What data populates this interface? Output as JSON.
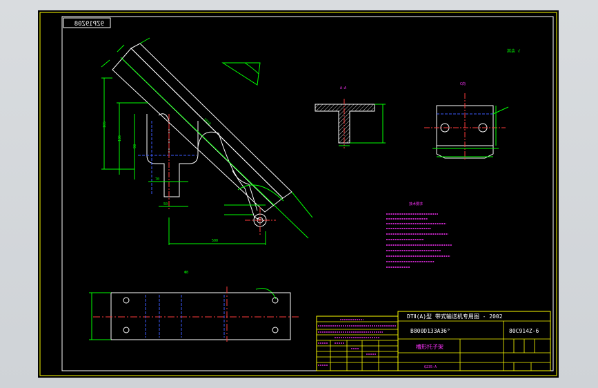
{
  "drawing_number_mirrored": "9ZP19Z08",
  "views": {
    "section_label": "A-A",
    "end_view_label": "C向",
    "roughness_mark": "其余 √"
  },
  "technical_requirements": {
    "title": "技术要求"
  },
  "title_block": {
    "header": "DTⅡ(A)型  带式输送机专用图 - 2002",
    "part_code": "B800D133A36°",
    "drawing_code": "80C914Z-6",
    "part_name": "槽形托子架",
    "material": "Q235-A"
  },
  "colors": {
    "frame": "#ffff00",
    "outline": "#ffffff",
    "dimension": "#00ff00",
    "center_line": "#ff3b3b",
    "hidden_line": "#3b5bff",
    "annotation": "#ff33ff",
    "hatch": "#c8c8c8"
  }
}
